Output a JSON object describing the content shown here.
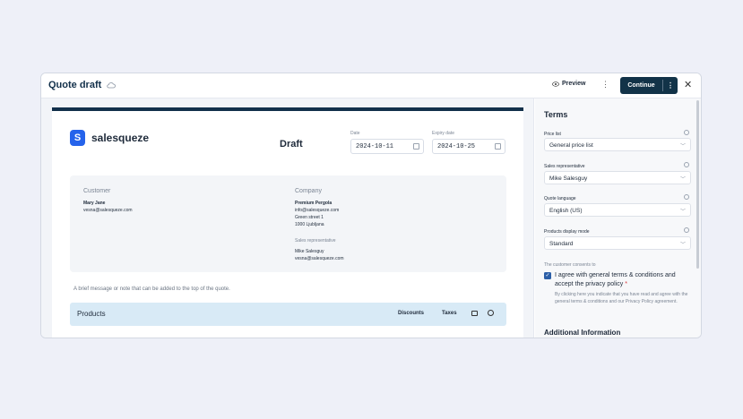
{
  "header": {
    "title": "Quote draft",
    "preview_label": "Preview",
    "continue_label": "Continue"
  },
  "document": {
    "brand": "salesqueze",
    "status_title": "Draft",
    "date_label": "Date",
    "date_value": "2024-10-11",
    "expiry_label": "Expiry date",
    "expiry_value": "2024-10-25",
    "customer": {
      "heading": "Customer",
      "name": "Mary Jane",
      "email": "vesna@salesqueze.com"
    },
    "company": {
      "heading": "Company",
      "name": "Premium Pergola",
      "email": "info@salesqueze.com",
      "street": "Green street 1",
      "city": "1000 Ljubljana",
      "rep_heading": "Sales representative",
      "rep_name": "Mike Salesguy",
      "rep_email": "vesna@salesqueze.com"
    },
    "note": "A brief message or note that can be added to the top of the quote.",
    "products": {
      "title": "Products",
      "discounts": "Discounts",
      "taxes": "Taxes"
    }
  },
  "terms": {
    "title": "Terms",
    "price_list_label": "Price list",
    "price_list_value": "General price list",
    "sales_rep_label": "Sales representative",
    "sales_rep_value": "Mike Salesguy",
    "language_label": "Quote language",
    "language_value": "English (US)",
    "display_mode_label": "Products display mode",
    "display_mode_value": "Standard",
    "consent_heading": "The customer consents to",
    "consent_text": "I agree with general terms & conditions and accept the privacy policy",
    "consent_required": "*",
    "consent_subtext": "By clicking here you indicate that you have read and agree with the general terms & conditions and our Privacy Policy agreement.",
    "additional_info": "Additional Information"
  },
  "colors": {
    "accent_dark": "#123348",
    "brand_blue": "#2563eb",
    "products_bg": "#d8eaf6"
  }
}
